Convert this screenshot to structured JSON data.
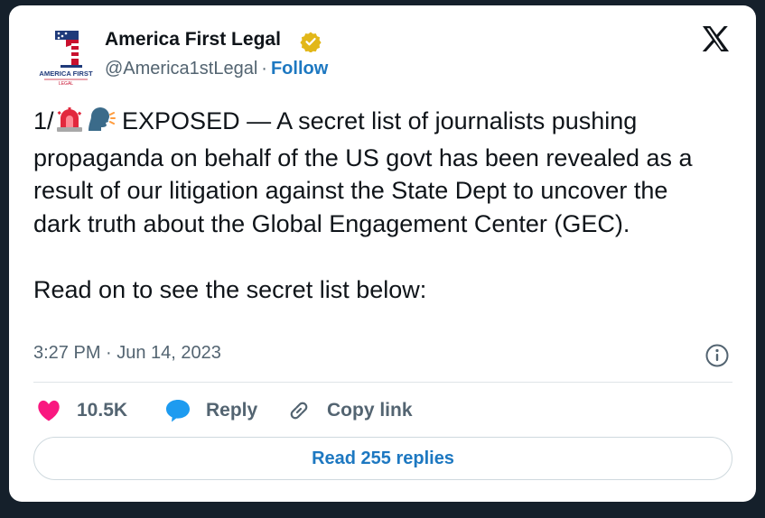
{
  "author": {
    "name": "America First Legal",
    "handle": "@America1stLegal",
    "separator": "·",
    "follow_label": "Follow",
    "verified_color": "#e2b719",
    "avatar_text_top": "AMERICA FIRST",
    "avatar_text_bottom": "LEGAL"
  },
  "tweet": {
    "prefix": "1/",
    "emojis": [
      "rotating-light-emoji",
      "speaking-head-emoji"
    ],
    "text_after_emoji": " EXPOSED — A secret list of journalists pushing propaganda on behalf of the US govt has been revealed as a result of our litigation against the State Dept to uncover the dark truth about the Global Engagement Center (GEC).\n\nRead on to see the secret list below:",
    "timestamp": "3:27 PM · Jun 14, 2023"
  },
  "actions": {
    "like_count": "10.5K",
    "reply_label": "Reply",
    "copy_label": "Copy link"
  },
  "read_replies_label": "Read 255 replies",
  "colors": {
    "link": "#1d78c1",
    "like": "#f91880",
    "reply_icon": "#1d9bf0",
    "muted": "#536471"
  }
}
